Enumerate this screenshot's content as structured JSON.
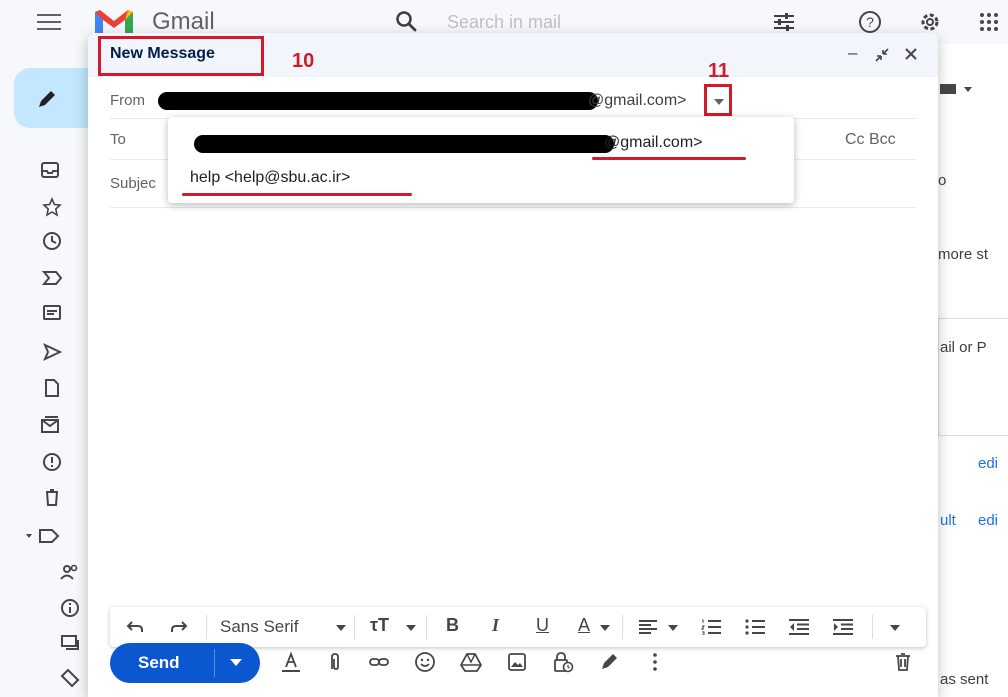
{
  "topbar": {
    "app_name": "Gmail",
    "search_placeholder": "Search in mail"
  },
  "compose": {
    "title": "New Message",
    "from_label": "From",
    "from_email_suffix": "@gmail.com>",
    "to_label": "To",
    "cc_bcc": "Cc Bcc",
    "subject_label": "Subject",
    "subject_visible": "Subjec",
    "dropdown": {
      "option1_suffix": "@gmail.com>",
      "option2": "help <help@sbu.ac.ir>"
    },
    "toolbar": {
      "font": "Sans Serif"
    },
    "send_label": "Send"
  },
  "annotations": {
    "label_10": "10",
    "label_11": "11"
  },
  "background": {
    "text1": "more st",
    "text2": "ail or P",
    "link1": "edi",
    "text3": "ult",
    "link2": "edi",
    "text4": "as sent",
    "letter": "o"
  },
  "colors": {
    "annotation": "#d11a2a",
    "send_button": "#0b57d0",
    "compose_header": "#f2f6fc"
  }
}
